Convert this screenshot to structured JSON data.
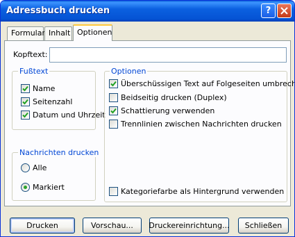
{
  "window": {
    "title": "Adressbuch drucken"
  },
  "tabs": [
    {
      "label": "Formular",
      "active": false
    },
    {
      "label": "Inhalt",
      "active": false
    },
    {
      "label": "Optionen",
      "active": true
    }
  ],
  "header_field": {
    "label": "Kopftext:",
    "value": ""
  },
  "footer_group": {
    "title": "Fußtext",
    "items": [
      {
        "label": "Name",
        "checked": true
      },
      {
        "label": "Seitenzahl",
        "checked": true
      },
      {
        "label": "Datum und Uhrzeit",
        "checked": true
      }
    ]
  },
  "print_messages_group": {
    "title": "Nachrichten drucken",
    "items": [
      {
        "label": "Alle",
        "selected": false
      },
      {
        "label": "Markiert",
        "selected": true
      }
    ]
  },
  "options_group": {
    "title": "Optionen",
    "items": [
      {
        "label": "Überschüssigen Text auf Folgeseiten umbrechen",
        "checked": true
      },
      {
        "label": "Beidseitig drucken (Duplex)",
        "checked": false
      },
      {
        "label": "Schattierung verwenden",
        "checked": true
      },
      {
        "label": "Trennlinien zwischen Nachrichten drucken",
        "checked": false
      }
    ],
    "category_color": {
      "label": "Kategoriefarbe als Hintergrund verwenden",
      "checked": false
    }
  },
  "buttons": {
    "print": "Drucken",
    "preview": "Vorschau...",
    "printer_setup": "Druckereinrichtung...",
    "close": "Schließen"
  },
  "colors": {
    "titlebar": "#0553d4",
    "group_title": "#0046d5",
    "check": "#21a121",
    "tab_highlight": "#ffc83c"
  }
}
